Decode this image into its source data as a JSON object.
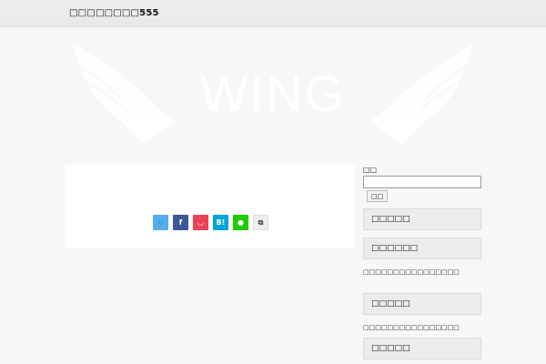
{
  "header": {
    "title": "□□□□□□□□555"
  },
  "hero": {
    "logo_text": "WING"
  },
  "share": {
    "buttons": [
      {
        "name": "twitter",
        "glyph": "🐦",
        "color": "#55acee"
      },
      {
        "name": "facebook",
        "glyph": "f",
        "color": "#3b5998"
      },
      {
        "name": "pocket",
        "glyph": "◡",
        "color": "#ee4056"
      },
      {
        "name": "hatena",
        "glyph": "B!",
        "color": "#00a4de"
      },
      {
        "name": "line",
        "glyph": "●",
        "color": "#1dcd00"
      },
      {
        "name": "copy",
        "glyph": "⧉",
        "color": "#eeeeee"
      }
    ]
  },
  "sidebar": {
    "search_label": "□□",
    "search_value": "",
    "search_button": "□□",
    "widgets": [
      {
        "title": "□□□□□"
      },
      {
        "title": "□□□□□□",
        "text": "□□□□□□□□□□□□□□□□"
      },
      {
        "title": "□□□□□",
        "text": "□□□□□□□□□□□□□□□□"
      },
      {
        "title": "□□□□□"
      }
    ]
  }
}
